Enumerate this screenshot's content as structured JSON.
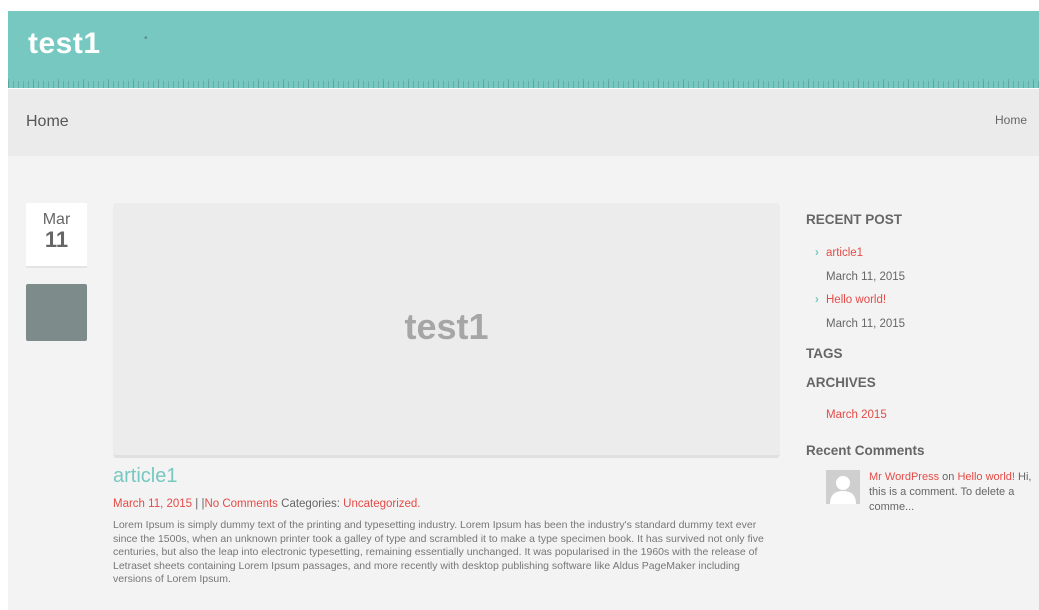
{
  "header": {
    "site_title": "test1",
    "accent_color": "#76c8c0"
  },
  "title_bar": {
    "page_title": "Home",
    "breadcrumb": "Home"
  },
  "post": {
    "month": "Mar",
    "day": "11",
    "featured_text": "test1",
    "title": "article1",
    "date": "March 11, 2015",
    "separator": "| |",
    "comments_link": "No Comments",
    "categories_label": "Categories:",
    "category": "Uncategorized.",
    "excerpt": "Lorem Ipsum is simply dummy text of the printing and typesetting industry. Lorem Ipsum has been the industry's standard dummy text ever since the 1500s, when an unknown printer took a galley of type and scrambled it to make a type specimen book. It has survived not only five centuries, but also the leap into electronic typesetting, remaining essentially unchanged. It was popularised in the 1960s with the release of Letraset sheets containing Lorem Ipsum passages, and more recently with desktop publishing software like Aldus PageMaker including versions of Lorem Ipsum."
  },
  "sidebar": {
    "recent_post_title": "RECENT POST",
    "recent_posts": [
      {
        "title": "article1",
        "date": "March 11, 2015"
      },
      {
        "title": "Hello world!",
        "date": "March 11, 2015"
      }
    ],
    "tags_title": "TAGS",
    "archives_title": "ARCHIVES",
    "archives": [
      "March 2015"
    ],
    "recent_comments_title": "Recent Comments",
    "recent_comment": {
      "author": "Mr WordPress",
      "on_word": "on",
      "post": "Hello world!",
      "text": "Hi, this is a comment. To delete a comme..."
    },
    "link_color": "#e44b47"
  }
}
